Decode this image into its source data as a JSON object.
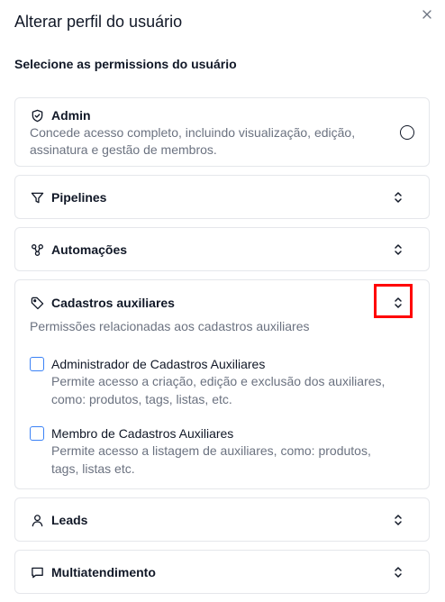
{
  "dialog": {
    "title": "Alterar perfil do usuário",
    "section_label": "Selecione as permissions do usuário"
  },
  "permissions": [
    {
      "key": "admin",
      "title": "Admin",
      "icon": "shield-icon",
      "description": "Concede acesso completo, incluindo visualização, edição, assinatura e gestão de membros."
    },
    {
      "key": "pipelines",
      "title": "Pipelines",
      "icon": "filter-icon"
    },
    {
      "key": "automacoes",
      "title": "Automações",
      "icon": "workflow-icon"
    },
    {
      "key": "cadastros",
      "title": "Cadastros auxiliares",
      "icon": "tag-icon",
      "description": "Permissões relacionadas aos cadastros auxiliares",
      "options": [
        {
          "title": "Administrador de Cadastros Auxiliares",
          "description": "Permite acesso a criação, edição e exclusão dos auxiliares, como: produtos, tags, listas, etc."
        },
        {
          "title": "Membro de Cadastros Auxiliares",
          "description": "Permite acesso a listagem de auxiliares, como: produtos, tags, listas etc."
        }
      ]
    },
    {
      "key": "leads",
      "title": "Leads",
      "icon": "user-icon"
    },
    {
      "key": "multiatendimento",
      "title": "Multiatendimento",
      "icon": "chat-icon"
    }
  ],
  "colors": {
    "highlight": "#ff0000",
    "checkbox_border": "#3b82f6",
    "card_border": "#e5e7eb"
  }
}
